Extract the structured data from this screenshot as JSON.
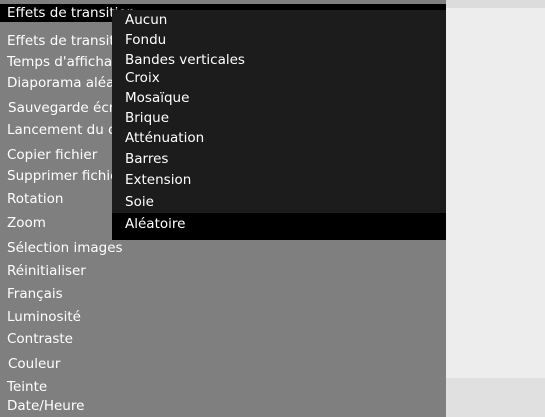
{
  "main_menu": {
    "items": [
      {
        "label": "Effets de transition",
        "selected": true
      },
      {
        "label": "Effets de transition"
      },
      {
        "label": "Temps d'affichage"
      },
      {
        "label": "Diaporama aléatoire"
      },
      {
        "label": "Sauvegarde écran"
      },
      {
        "label": "Lancement du diaporama"
      },
      {
        "label": "Copier fichier"
      },
      {
        "label": "Supprimer fichier"
      },
      {
        "label": "Rotation"
      },
      {
        "label": "Zoom"
      },
      {
        "label": "Sélection images"
      },
      {
        "label": "Réinitialiser"
      },
      {
        "label": "Français"
      },
      {
        "label": "Luminosité"
      },
      {
        "label": "Contraste"
      },
      {
        "label": "Couleur"
      },
      {
        "label": "Teinte"
      },
      {
        "label": "Date/Heure"
      }
    ]
  },
  "submenu": {
    "items": [
      {
        "label": "Aucun"
      },
      {
        "label": "Fondu"
      },
      {
        "label": "Bandes verticales"
      },
      {
        "label": "Croix"
      },
      {
        "label": "Mosaïque"
      },
      {
        "label": "Brique"
      },
      {
        "label": "Atténuation"
      },
      {
        "label": "Barres"
      },
      {
        "label": "Extension"
      },
      {
        "label": "Soie"
      },
      {
        "label": "Aléatoire",
        "selected": true
      }
    ]
  },
  "colors": {
    "menu_bg": "#7f7f7f",
    "submenu_bg": "#1c1c1c",
    "selected_bg": "#000000",
    "text": "#ffffff",
    "right_panel": "#ededed"
  }
}
